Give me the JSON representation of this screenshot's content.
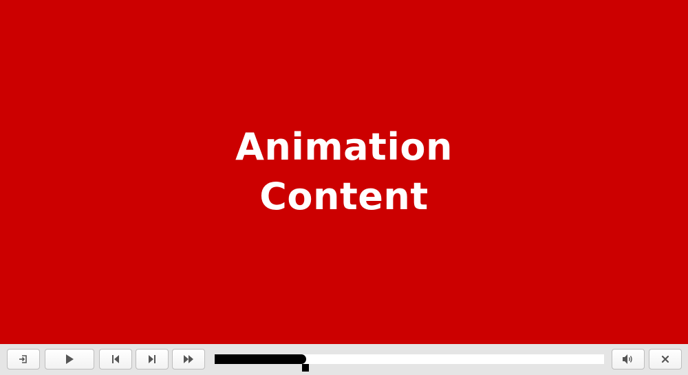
{
  "stage": {
    "background_color": "#cc0000",
    "title_line_1": "Animation",
    "title_line_2": "Content"
  },
  "controls": {
    "background_color": "#e5e5e5",
    "icons": {
      "exit": "exit-icon",
      "play": "play-icon",
      "previous": "skip-previous-icon",
      "next": "skip-next-icon",
      "fast_forward": "fast-forward-icon",
      "volume": "volume-icon",
      "close": "close-icon"
    },
    "progress_fraction": 0.235
  }
}
